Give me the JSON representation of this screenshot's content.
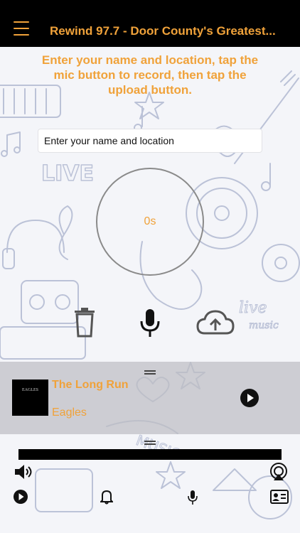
{
  "header": {
    "title": "Rewind 97.7 - Door County's Greatest..."
  },
  "instructions": "Enter your name and location, tap the mic button to record, then tap the upload button.",
  "name_input": {
    "placeholder": "Enter your name and location",
    "value": ""
  },
  "recorder": {
    "timer": "0s"
  },
  "now_playing": {
    "song": "The Long Run",
    "artist": "Eagles",
    "album_art_text": "EAGLES"
  },
  "colors": {
    "accent": "#f0a23a",
    "header_bg": "#000000"
  },
  "icons": {
    "menu": "hamburger-menu-icon",
    "delete": "trash-icon",
    "mic": "microphone-icon",
    "upload": "cloud-upload-icon",
    "play": "play-icon",
    "volume": "speaker-icon",
    "airplay": "airplay-icon",
    "notifications": "bell-icon",
    "contact": "contact-card-icon"
  }
}
